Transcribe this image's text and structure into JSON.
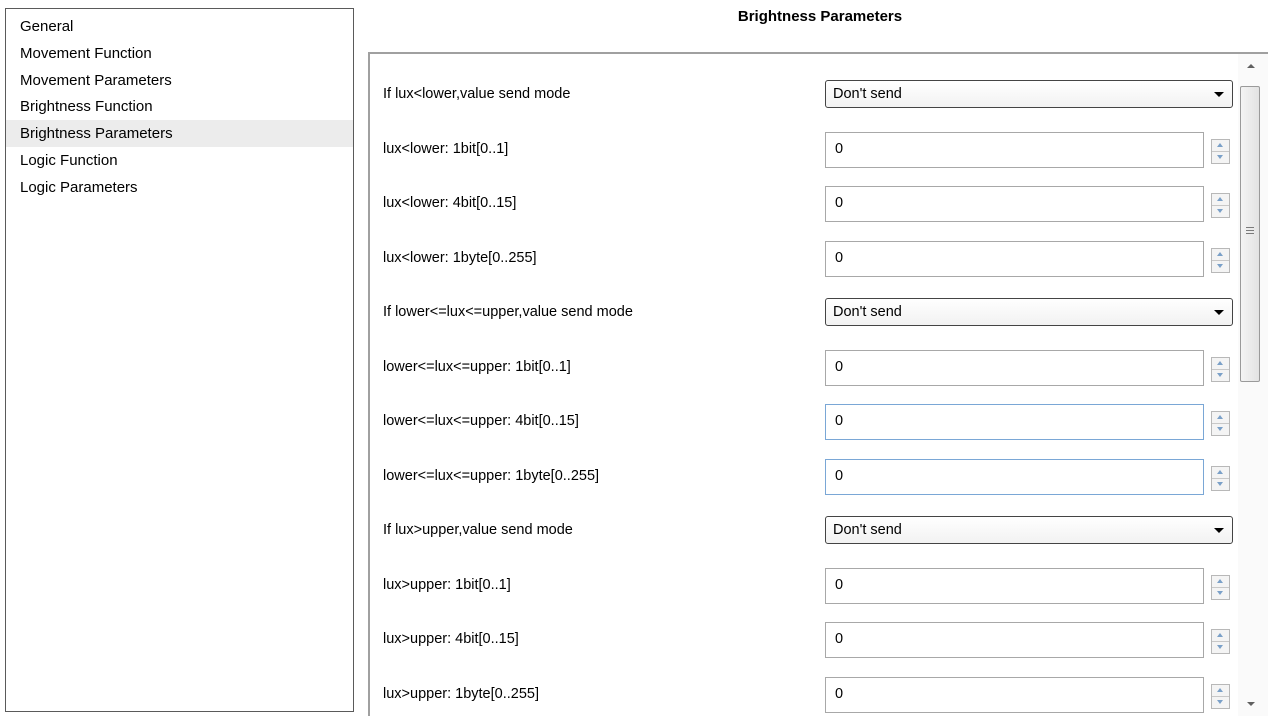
{
  "nav": {
    "items": [
      {
        "label": "General",
        "selected": false
      },
      {
        "label": "Movement Function",
        "selected": false
      },
      {
        "label": "Movement Parameters",
        "selected": false
      },
      {
        "label": "Brightness Function",
        "selected": false
      },
      {
        "label": "Brightness Parameters",
        "selected": true
      },
      {
        "label": "Logic Function",
        "selected": false
      },
      {
        "label": "Logic Parameters",
        "selected": false
      }
    ]
  },
  "page": {
    "title": "Brightness Parameters"
  },
  "params": [
    {
      "label": "If lux<lower,value send mode",
      "type": "select",
      "value": "Don't send"
    },
    {
      "label": "lux<lower: 1bit[0..1]",
      "type": "number",
      "value": "0"
    },
    {
      "label": "lux<lower: 4bit[0..15]",
      "type": "number",
      "value": "0"
    },
    {
      "label": "lux<lower: 1byte[0..255]",
      "type": "number",
      "value": "0"
    },
    {
      "label": "If lower<=lux<=upper,value send mode",
      "type": "select",
      "value": "Don't send"
    },
    {
      "label": "lower<=lux<=upper: 1bit[0..1]",
      "type": "number",
      "value": "0"
    },
    {
      "label": "lower<=lux<=upper: 4bit[0..15]",
      "type": "number",
      "value": "0",
      "focused": true
    },
    {
      "label": "lower<=lux<=upper: 1byte[0..255]",
      "type": "number",
      "value": "0",
      "focused": true
    },
    {
      "label": "If lux>upper,value send mode",
      "type": "select",
      "value": "Don't send"
    },
    {
      "label": "lux>upper: 1bit[0..1]",
      "type": "number",
      "value": "0"
    },
    {
      "label": "lux>upper: 4bit[0..15]",
      "type": "number",
      "value": "0"
    },
    {
      "label": "lux>upper: 1byte[0..255]",
      "type": "number",
      "value": "0"
    }
  ]
}
